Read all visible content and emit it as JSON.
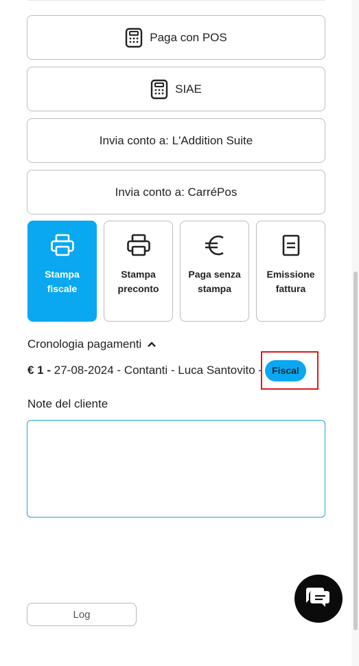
{
  "actions": {
    "pay_pos": "Paga con POS",
    "siae": "SIAE",
    "send_addition": "Invia conto a: L'Addition Suite",
    "send_carrepos": "Invia conto a: CarréPos"
  },
  "tiles": [
    {
      "label": "Stampa fiscale",
      "icon": "printer-icon",
      "active": true
    },
    {
      "label": "Stampa preconto",
      "icon": "printer-icon",
      "active": false
    },
    {
      "label": "Paga senza stampa",
      "icon": "euro-icon",
      "active": false
    },
    {
      "label": "Emissione fattura",
      "icon": "document-icon",
      "active": false
    }
  ],
  "history": {
    "title": "Cronologia pagamenti",
    "toggle_icon": "chevron-up-icon",
    "entry": {
      "amount": "€ 1 -",
      "details": " 27-08-2024 - Contanti - Luca Santovito -",
      "badge": "Fiscal"
    }
  },
  "notes": {
    "label": "Note del cliente",
    "value": ""
  },
  "log_button": "Log",
  "chat_icon": "chat-bubbles-icon",
  "colors": {
    "accent": "#0aa8f0",
    "highlight": "#e0161b",
    "notes_border": "#1aa6c8",
    "fab": "#0b0b0b"
  }
}
